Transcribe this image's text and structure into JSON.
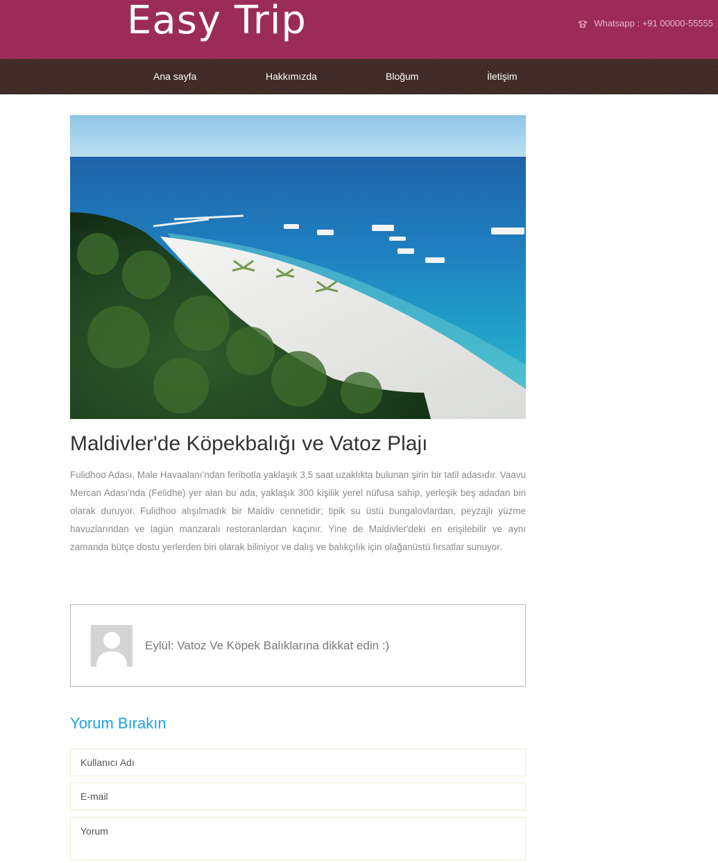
{
  "header": {
    "logo": "Easy Trip",
    "contact": "Whatsapp : +91 00000-55555",
    "phone_icon": "phone-icon",
    "bg_color": "#9b2c57"
  },
  "nav": {
    "items": [
      {
        "label": "Ana sayfa"
      },
      {
        "label": "Hakkımızda"
      },
      {
        "label": "Bloğum"
      },
      {
        "label": "İletişim"
      }
    ]
  },
  "post": {
    "title": "Maldivler'de Köpekbalığı ve Vatoz Plajı",
    "body": "Fulidhoo Adası, Male Havaalanı'ndan feribotla yaklaşık 3,5 saat uzaklıkta bulunan şirin bir tatil adasıdır. Vaavu Mercan Adası'nda (Felidhe) yer alan bu ada, yaklaşık 300 kişilik yerel nüfusa sahip, yerleşik beş adadan biri olarak duruyor. Fulidhoo alışılmadık bir Maldiv cennetidir; tipik su üstü bungalovlardan, peyzajlı yüzme havuzlarından ve lagün manzaralı restoranlardan kaçınır. Yine de Maldivler'deki en erişilebilir ve aynı zamanda bütçe dostu yerlerden biri olarak biliniyor ve dalış ve balıkçılık için olağanüstü fırsatlar sunuyor."
  },
  "comment": {
    "text": "Eylül: Vatoz Ve Köpek Balıklarına dikkat edin :)"
  },
  "form": {
    "title": "Yorum Bırakın",
    "username_placeholder": "Kullanıcı Adı",
    "email_placeholder": "E-mail",
    "comment_placeholder": "Yorum"
  }
}
